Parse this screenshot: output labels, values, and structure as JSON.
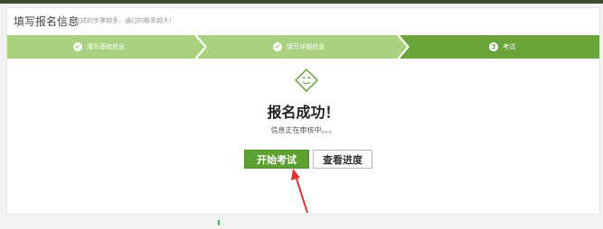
{
  "header": {
    "title": "填写报名信息",
    "subtitle": "完成的步骤越多，通过的概率越大！"
  },
  "steps": [
    {
      "label": "填写基础信息",
      "status": "done"
    },
    {
      "label": "填写详细信息",
      "status": "done"
    },
    {
      "label": "考试",
      "number": "3",
      "status": "current"
    }
  ],
  "result": {
    "title": "报名成功！",
    "message": "信息正在审核中。。。"
  },
  "buttons": {
    "start_exam": "开始考试",
    "view_progress": "查看进度"
  },
  "colors": {
    "step_done": "#a8d27f",
    "step_current": "#6aa53a",
    "primary_button": "#5ea133",
    "accent_icon": "#5ea133",
    "arrow": "#e03030"
  }
}
